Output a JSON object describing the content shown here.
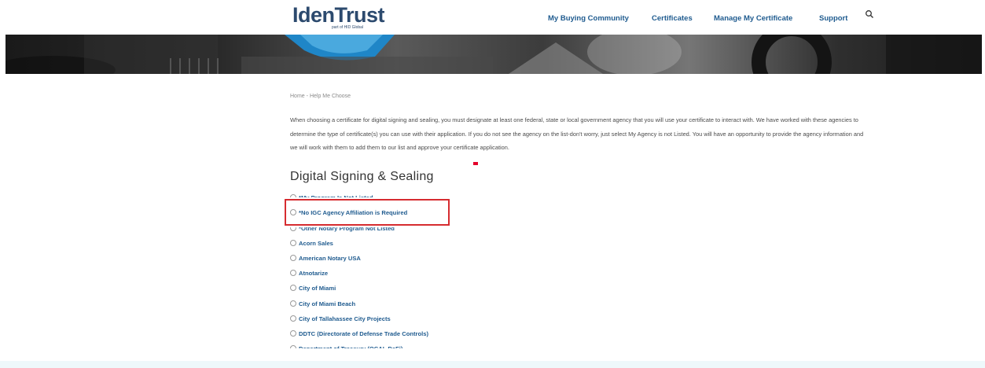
{
  "header": {
    "logo_text": "IdenTrust",
    "logo_subtext": "part of HID Global",
    "nav": [
      {
        "label": "My Buying Community"
      },
      {
        "label": "Certificates"
      },
      {
        "label": "Manage My Certificate"
      },
      {
        "label": "Support"
      }
    ],
    "search_icon": "search-icon"
  },
  "breadcrumb": {
    "home": "Home",
    "separator": "-",
    "current": "Help Me Choose"
  },
  "intro_text": "When choosing a certificate for digital signing and sealing, you must designate at least one federal, state or local government agency that you will use your certificate to interact with.  We have worked with these agencies to determine the type of certificate(s) you can use with their application.  If you do not see the agency on the list-don't worry, just select My Agency is not Listed.  You will have an opportunity to provide the agency information and we will work with them to add them to our list and approve your certificate application.",
  "section_title": "Digital Signing & Sealing",
  "options": [
    {
      "label": "*My Program Is Not Listed"
    },
    {
      "label": "*No IGC Agency Affiliation is Required"
    },
    {
      "label": "*Other Notary Program Not Listed"
    },
    {
      "label": "Acorn Sales"
    },
    {
      "label": "American Notary USA"
    },
    {
      "label": "Atnotarize"
    },
    {
      "label": "City of Miami"
    },
    {
      "label": "City of Miami Beach"
    },
    {
      "label": "City of Tallahassee City Projects"
    },
    {
      "label": "DDTC (Directorate of Defense Trade Controls)"
    },
    {
      "label": "Department of Treasury (OCAL DeFi)"
    }
  ],
  "colors": {
    "brand": "#2c4a6e",
    "link": "#1f5b8f",
    "highlight": "#d62c30",
    "accent": "#e4002b"
  }
}
